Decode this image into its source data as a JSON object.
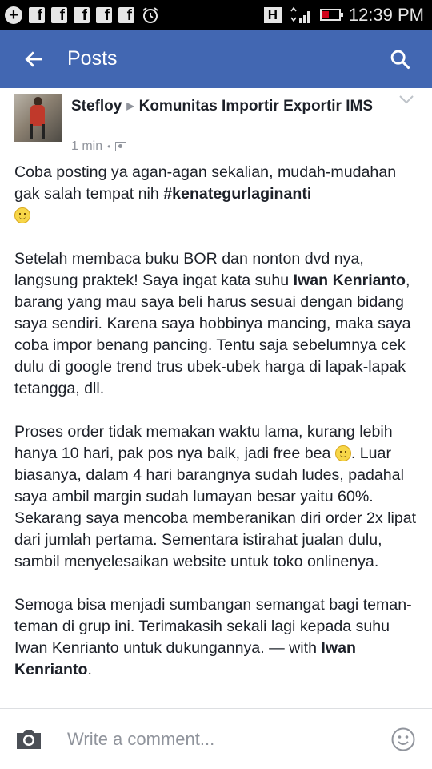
{
  "status_bar": {
    "time": "12:39 PM",
    "network_badge": "H",
    "icons": [
      "add-circle-icon",
      "facebook-notification-icon",
      "facebook-notification-icon",
      "facebook-notification-icon",
      "facebook-notification-icon",
      "facebook-notification-icon",
      "alarm-icon",
      "signal-icon",
      "battery-low-icon"
    ],
    "battery_color": "#d0021b"
  },
  "app_bar": {
    "title": "Posts",
    "back_icon": "back-arrow-icon",
    "search_icon": "search-icon",
    "color": "#4267b2"
  },
  "post": {
    "author": "Stefloy",
    "group": "Komunitas Importir Exportir IMS",
    "time": "1 min",
    "audience_icon": "group-audience-icon",
    "menu_icon": "chevron-down-icon",
    "p1_text": "Coba posting ya agan-agan sekalian, mudah-mudahan gak salah tempat nih ",
    "p1_hashtag": "#kenategurlaginanti",
    "p2_a": "Setelah membaca buku BOR dan nonton dvd nya, langsung praktek! Saya ingat kata suhu ",
    "p2_name": "Iwan Kenrianto",
    "p2_b": ", barang yang mau saya beli harus sesuai dengan bidang saya sendiri. Karena saya hobbinya mancing, maka saya coba impor benang pancing. Tentu saja sebelumnya cek dulu di google trend trus ubek-ubek harga di lapak-lapak tetangga, dll.",
    "p3_a": "Proses order tidak memakan waktu lama, kurang lebih hanya 10 hari, pak pos nya baik, jadi free bea ",
    "p3_b": ". Luar biasanya, dalam 4 hari barangnya sudah ludes, padahal saya ambil margin sudah lumayan besar yaitu 60%. Sekarang saya mencoba memberanikan diri order 2x lipat dari jumlah pertama. Sementara istirahat jualan dulu, sambil menyelesaikan website untuk toko onlinenya.",
    "p4_a": "Semoga bisa menjadi sumbangan semangat bagi teman-teman di grup ini. Terimakasih sekali lagi kepada suhu Iwan Kenrianto untuk dukungannya. — with ",
    "p4_tag": "Iwan Kenrianto",
    "p4_end": "."
  },
  "comment_bar": {
    "placeholder": "Write a comment...",
    "camera_icon": "camera-icon",
    "emoji_icon": "smiley-icon"
  }
}
